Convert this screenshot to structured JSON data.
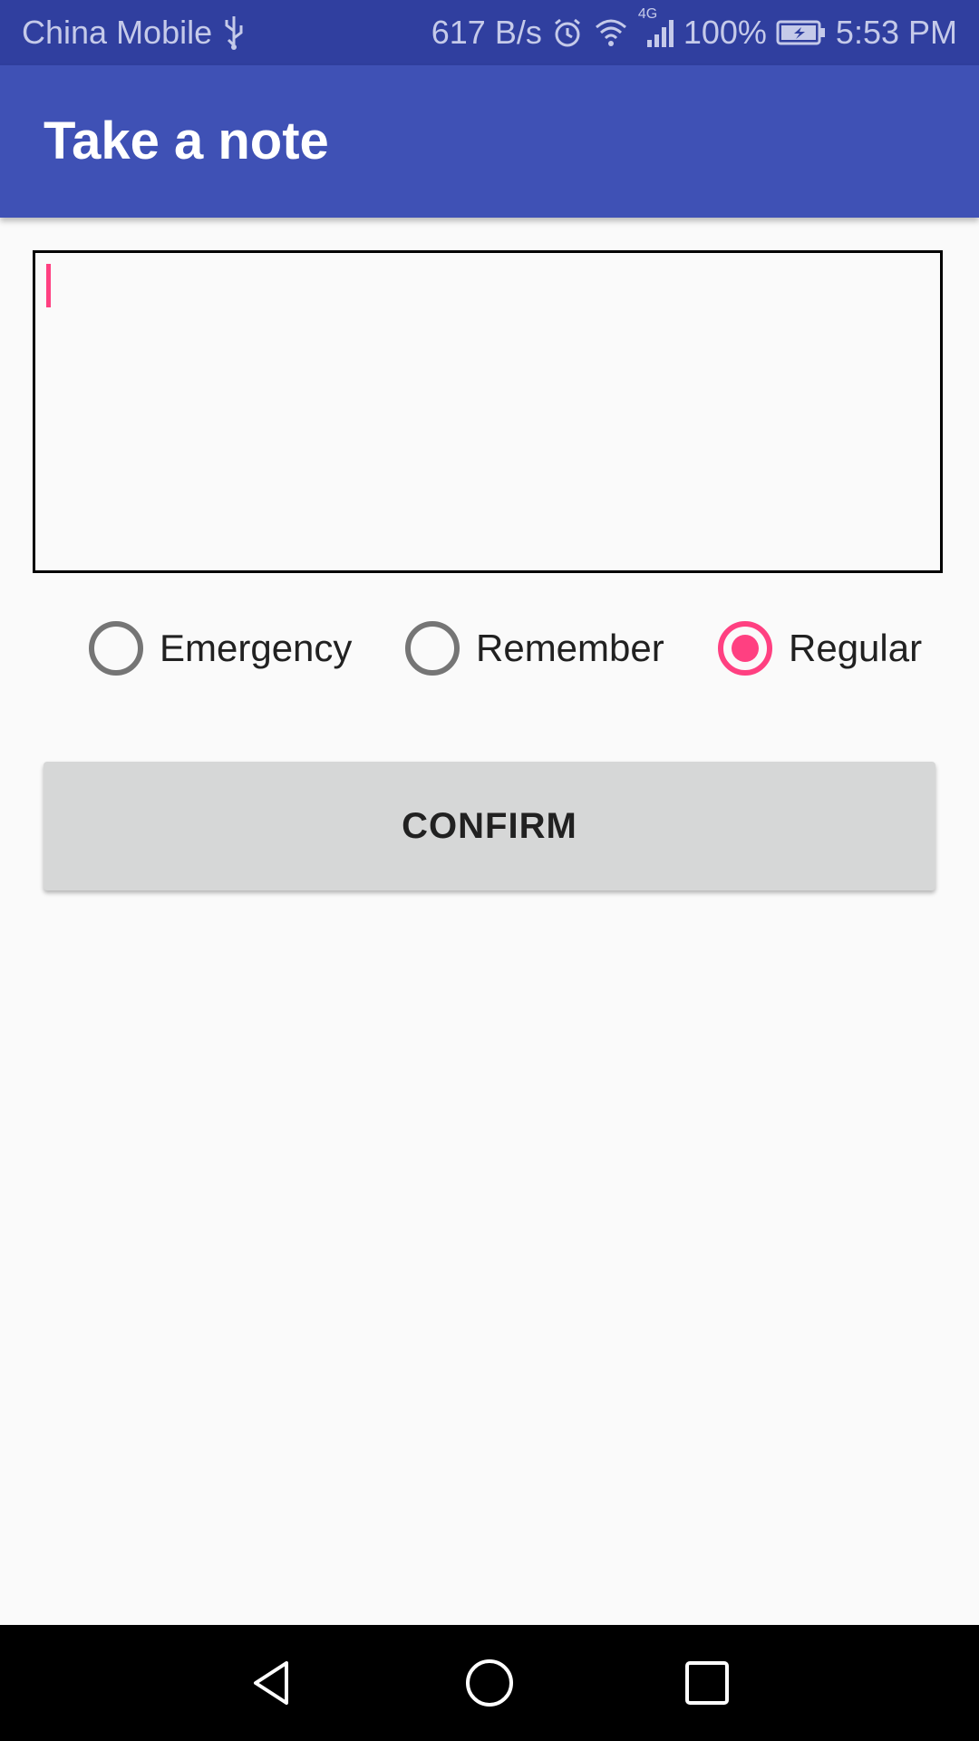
{
  "status_bar": {
    "carrier": "China Mobile",
    "speed": "617 B/s",
    "network": "4G",
    "battery": "100%",
    "time": "5:53 PM",
    "icons": [
      "usb-icon",
      "alarm-icon",
      "wifi-icon",
      "signal-icon",
      "battery-charging-icon"
    ]
  },
  "app_bar": {
    "title": "Take a note"
  },
  "note": {
    "value": "",
    "placeholder": ""
  },
  "priority": {
    "options": [
      {
        "label": "Emergency",
        "checked": false
      },
      {
        "label": "Remember",
        "checked": false
      },
      {
        "label": "Regular",
        "checked": true
      }
    ]
  },
  "confirm": {
    "label": "CONFIRM"
  },
  "navigation": {
    "icons": [
      "back-icon",
      "home-icon",
      "recents-icon"
    ]
  },
  "colors": {
    "status_bar": "#303f9f",
    "app_bar": "#3f51b5",
    "accent": "#ff4081",
    "button": "#d6d7d7"
  }
}
